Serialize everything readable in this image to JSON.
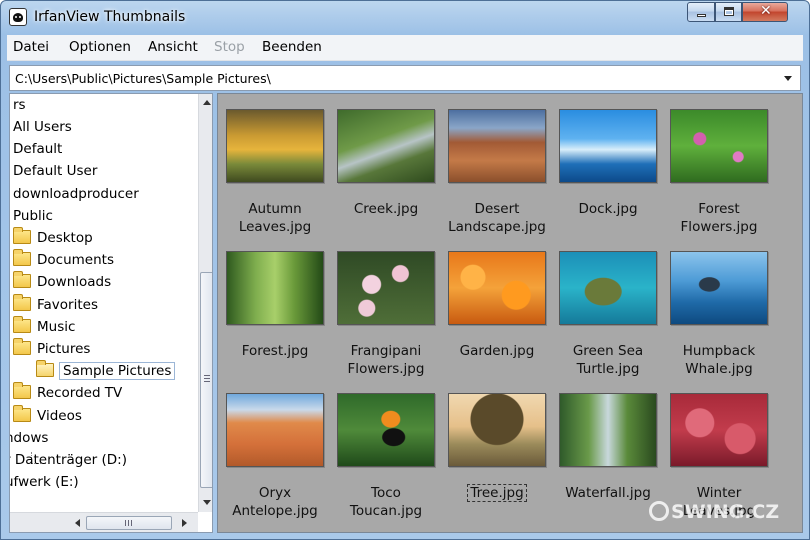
{
  "window": {
    "title": "IrfanView Thumbnails"
  },
  "menu": [
    {
      "label": "Datei",
      "enabled": true
    },
    {
      "label": "Optionen",
      "enabled": true
    },
    {
      "label": "Ansicht",
      "enabled": true
    },
    {
      "label": "Stop",
      "enabled": false
    },
    {
      "label": "Beenden",
      "enabled": true
    }
  ],
  "address": {
    "path": "C:\\Users\\Public\\Pictures\\Sample Pictures\\"
  },
  "tree": [
    {
      "label": "rs",
      "icon": "none"
    },
    {
      "label": "All Users",
      "icon": "none"
    },
    {
      "label": "Default",
      "icon": "none"
    },
    {
      "label": "Default User",
      "icon": "none"
    },
    {
      "label": "downloadproducer",
      "icon": "none"
    },
    {
      "label": "Public",
      "icon": "none"
    },
    {
      "label": "Desktop",
      "icon": "folder-icon"
    },
    {
      "label": "Documents",
      "icon": "folder-icon"
    },
    {
      "label": "Downloads",
      "icon": "folder-icon"
    },
    {
      "label": "Favorites",
      "icon": "folder-icon"
    },
    {
      "label": "Music",
      "icon": "folder-icon"
    },
    {
      "label": "Pictures",
      "icon": "folder-icon"
    },
    {
      "label": "Sample Pictures",
      "icon": "open-folder-icon",
      "selected": true
    },
    {
      "label": "Recorded TV",
      "icon": "folder-icon"
    },
    {
      "label": "Videos",
      "icon": "folder-icon"
    },
    {
      "label": "ndows",
      "icon": "none"
    },
    {
      "label": "r Datenträger (D:)",
      "icon": "none"
    },
    {
      "label": "ufwerk (E:)",
      "icon": "none"
    }
  ],
  "thumbnails": [
    {
      "caption": [
        "Autumn",
        "Leaves.jpg"
      ]
    },
    {
      "caption": [
        "Creek.jpg"
      ]
    },
    {
      "caption": [
        "Desert",
        "Landscape.jpg"
      ]
    },
    {
      "caption": [
        "Dock.jpg"
      ]
    },
    {
      "caption": [
        "Forest",
        "Flowers.jpg"
      ]
    },
    {
      "caption": [
        "Forest.jpg"
      ]
    },
    {
      "caption": [
        "Frangipani",
        "Flowers.jpg"
      ]
    },
    {
      "caption": [
        "Garden.jpg"
      ]
    },
    {
      "caption": [
        "Green Sea",
        "Turtle.jpg"
      ]
    },
    {
      "caption": [
        "Humpback",
        "Whale.jpg"
      ]
    },
    {
      "caption": [
        "Oryx",
        "Antelope.jpg"
      ]
    },
    {
      "caption": [
        "Toco",
        "Toucan.jpg"
      ]
    },
    {
      "caption": [
        "Tree.jpg"
      ],
      "focused": true
    },
    {
      "caption": [
        "Waterfall.jpg"
      ]
    },
    {
      "caption": [
        "Winter",
        "Leaves.jpg"
      ]
    }
  ],
  "watermark": "SWING.CZ"
}
